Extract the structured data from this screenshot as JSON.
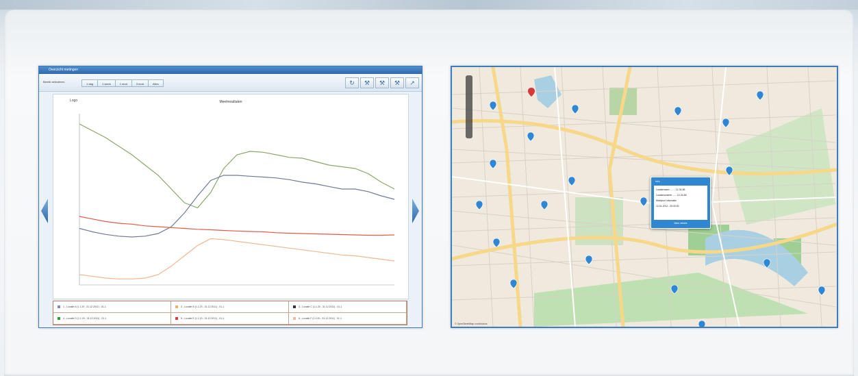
{
  "chart_window": {
    "title": "Overzicht metingen",
    "toolbar": {
      "label": "Bereik selecteren:",
      "range_buttons": [
        "1 dag",
        "1 week",
        "1 mnd",
        "3 mnd",
        "Alles"
      ],
      "tools": [
        "refresh-icon",
        "wrench-icon",
        "wrench-icon",
        "wrench-icon",
        "chart-icon"
      ]
    },
    "plot": {
      "logo": "Logo",
      "title": "Meetresultaten"
    },
    "legend": [
      {
        "label": "1 - Locatie A (1.1.20 - 31.12.2011) - 01-1",
        "color": "#7d8cb8"
      },
      {
        "label": "2 - Locatie B (1.1.20 - 31.12.2011) - 01-1",
        "color": "#e8b36a"
      },
      {
        "label": "3 - Locatie C (1.1.20 - 31.12.2011) - 01-1",
        "color": "#333333"
      },
      {
        "label": "4 - Locatie D (1.1.20 - 31.12.2011) - 01-1",
        "color": "#2c9b3a"
      },
      {
        "label": "5 - Locatie E (1.1.20 - 31.12.2011) - 01-1",
        "color": "#e23a3a"
      },
      {
        "label": "6 - Locatie F (1.1.20 - 31.12.2011) - 01-1",
        "color": "#f3b6a4"
      }
    ]
  },
  "chart_data": {
    "type": "line",
    "x": [
      0,
      1,
      2,
      3,
      4,
      5,
      6,
      7,
      8,
      9,
      10,
      11,
      12,
      13,
      14,
      15,
      16,
      17,
      18,
      19,
      20,
      21,
      22,
      23,
      24
    ],
    "ylim": [
      0,
      1000
    ],
    "series": [
      {
        "color": "#8aa86a",
        "values": [
          940,
          900,
          860,
          810,
          760,
          700,
          640,
          560,
          480,
          450,
          540,
          680,
          760,
          780,
          775,
          760,
          745,
          740,
          720,
          700,
          690,
          680,
          650,
          600,
          560
        ]
      },
      {
        "color": "#6d7a99",
        "values": [
          330,
          310,
          295,
          285,
          280,
          285,
          300,
          340,
          420,
          520,
          610,
          640,
          640,
          635,
          630,
          625,
          615,
          600,
          590,
          575,
          560,
          560,
          545,
          520,
          500
        ]
      },
      {
        "color": "#e05a4a",
        "values": [
          400,
          385,
          370,
          360,
          355,
          345,
          340,
          335,
          330,
          325,
          322,
          318,
          315,
          312,
          310,
          305,
          302,
          300,
          298,
          296,
          294,
          292,
          290,
          290,
          292
        ]
      },
      {
        "color": "#f1b78e",
        "values": [
          60,
          50,
          40,
          35,
          35,
          40,
          60,
          110,
          170,
          230,
          270,
          265,
          255,
          245,
          235,
          225,
          215,
          205,
          195,
          185,
          175,
          170,
          160,
          150,
          140
        ]
      }
    ]
  },
  "map_window": {
    "popup": {
      "title": "Info",
      "rows": [
        "Locatienaam ........ 12-34-56",
        "Locatienummer ...... 12-34-56",
        "Meetpunt informatie",
        "12-01-2012 - 00:00:00"
      ],
      "link": "Meer details"
    },
    "attribution": "© OpenStreetMap contributors"
  }
}
